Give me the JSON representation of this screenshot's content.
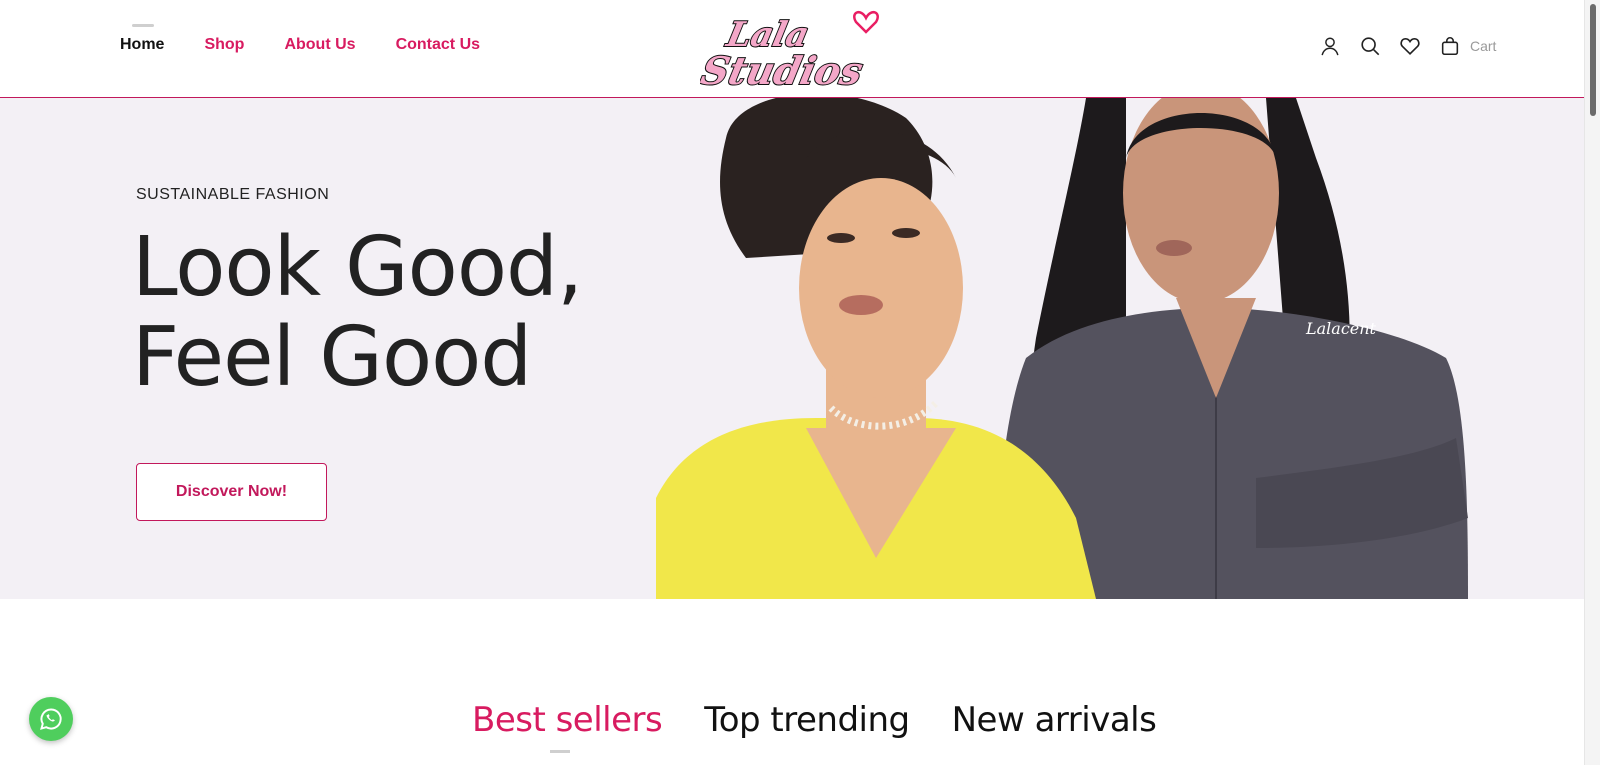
{
  "header": {
    "nav": [
      {
        "label": "Home",
        "active": true
      },
      {
        "label": "Shop",
        "active": false
      },
      {
        "label": "About Us",
        "active": false
      },
      {
        "label": "Contact Us",
        "active": false
      }
    ],
    "logo": {
      "line1": "Lala",
      "line2": "Studios",
      "icon": "heart-icon"
    },
    "actions": {
      "account_icon": "user-icon",
      "search_icon": "search-icon",
      "wishlist_icon": "heart-icon",
      "cart_icon": "shopping-bag-icon",
      "cart_label": "Cart"
    }
  },
  "hero": {
    "eyebrow": "SUSTAINABLE FASHION",
    "title_line1": "Look Good,",
    "title_line2": "Feel Good",
    "cta_label": "Discover Now!"
  },
  "product_tabs": [
    {
      "label": "Best sellers",
      "active": true
    },
    {
      "label": "Top trending",
      "active": false
    },
    {
      "label": "New arrivals",
      "active": false
    }
  ],
  "floating": {
    "whatsapp_icon": "whatsapp-icon"
  },
  "colors": {
    "accent": "#d81b60",
    "hero_bg": "#f3f0f5",
    "whatsapp": "#4fce5d",
    "logo_pink": "#f4a7c8"
  }
}
